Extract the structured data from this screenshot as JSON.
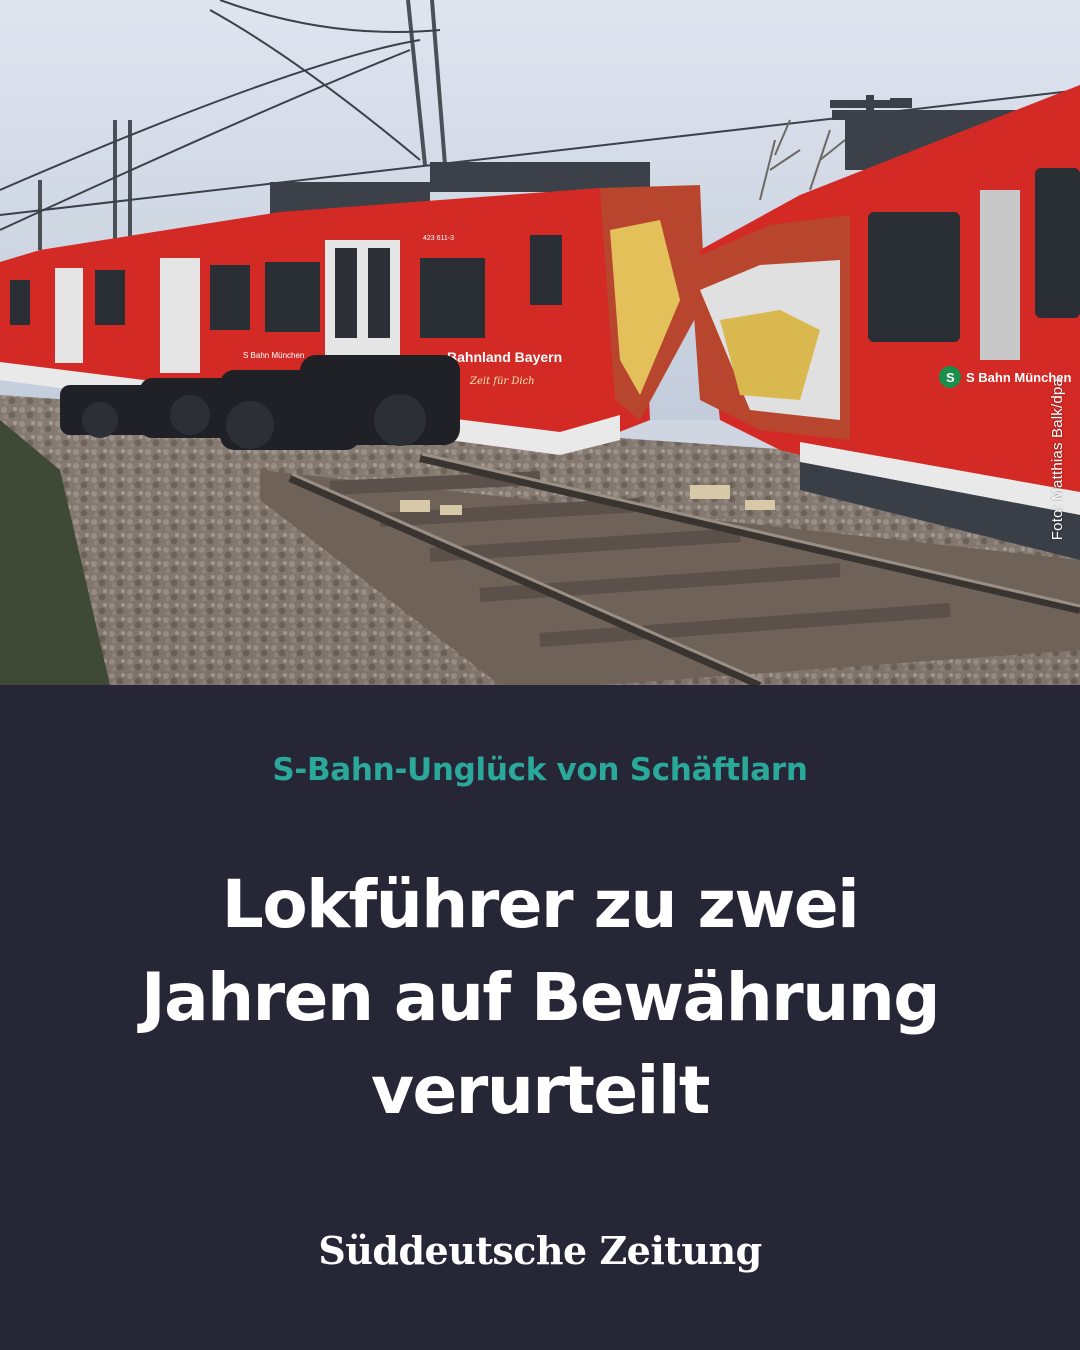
{
  "photo": {
    "subject": "train-crash-photo",
    "credit": "Foto: Matthias Balk/dpa",
    "car_labels": {
      "left_brand": "Bahnland Bayern",
      "left_slogan": "Zeit für Dich",
      "left_small": "S Bahn München",
      "right_brand": "S Bahn München",
      "left_number": "423 611-3"
    }
  },
  "kicker": "S-Bahn-Unglück von Schäftlarn",
  "headline": {
    "line1": "Lokführer zu zwei",
    "line2": "Jahren auf Bewährung",
    "line3": "verurteilt"
  },
  "brand": {
    "name": "Süddeutsche Zeitung"
  },
  "colors": {
    "background": "#272637",
    "kicker": "#2aa89a",
    "headline": "#ffffff",
    "train_red": "#d42a25"
  }
}
